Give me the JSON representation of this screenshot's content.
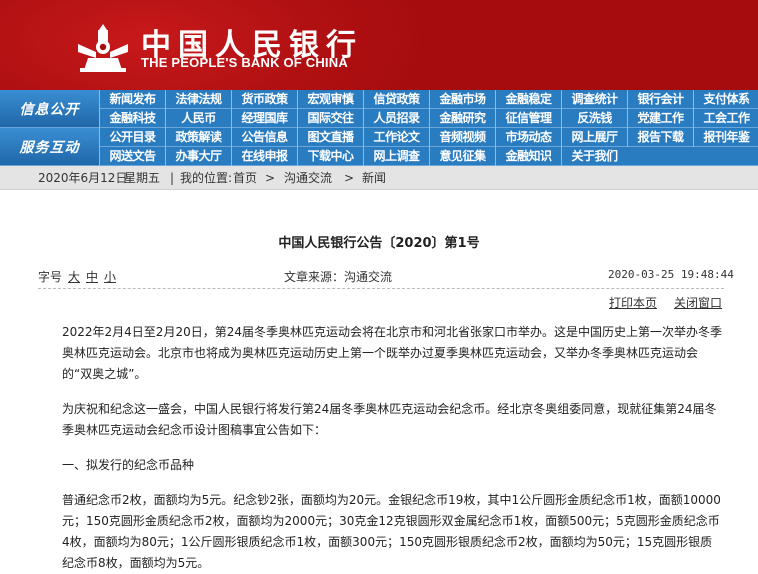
{
  "header": {
    "bank_name_cn": "中国人民银行",
    "bank_name_en": "THE PEOPLE'S BANK OF CHINA",
    "colors": {
      "brand_red": "#a50c0e",
      "nav_blue": "#2778bd"
    }
  },
  "nav": {
    "info_label": "信息公开",
    "service_label": "服务互动",
    "row1": [
      "新闻发布",
      "法律法规",
      "货币政策",
      "宏观审慎",
      "信贷政策",
      "金融市场",
      "金融稳定",
      "调查统计",
      "银行会计",
      "支付体系"
    ],
    "row2": [
      "金融科技",
      "人民币",
      "经理国库",
      "国际交往",
      "人员招录",
      "金融研究",
      "征信管理",
      "反洗钱",
      "党建工作",
      "工会工作"
    ],
    "row3": [
      "公开目录",
      "政策解读",
      "公告信息",
      "图文直播",
      "工作论文",
      "音频视频",
      "市场动态",
      "网上展厅",
      "报告下载",
      "报刊年鉴"
    ],
    "row4": [
      "网送文告",
      "办事大厅",
      "在线申报",
      "下载中心",
      "网上调查",
      "意见征集",
      "金融知识",
      "关于我们"
    ]
  },
  "breadcrumb": {
    "date": "2020年6月12日",
    "weekday": "星期五",
    "sep": "|",
    "location_label": "我的位置:",
    "home": "首页",
    "arrow1": ">",
    "section": "沟通交流",
    "arrow2": ">",
    "page": "新闻"
  },
  "article": {
    "title": "中国人民银行公告〔2020〕第1号",
    "font_size_label": "字号",
    "size_large": "大",
    "size_medium": "中",
    "size_small": "小",
    "source_label": "文章来源：沟通交流",
    "datetime": "2020-03-25 19:48:44",
    "print_label": "打印本页",
    "close_label": "关闭窗口",
    "paragraphs": [
      "2022年2月4日至2月20日，第24届冬季奥林匹克运动会将在北京市和河北省张家口市举办。这是中国历史上第一次举办冬季奥林匹克运动会。北京市也将成为奥林匹克运动历史上第一个既举办过夏季奥林匹克运动会，又举办冬季奥林匹克运动会的“双奥之城”。",
      "为庆祝和纪念这一盛会，中国人民银行将发行第24届冬季奥林匹克运动会纪念币。经北京冬奥组委同意，现就征集第24届冬季奥林匹克运动会纪念币设计图稿事宜公告如下：",
      "一、拟发行的纪念币品种",
      "普通纪念币2枚，面额均为5元。纪念钞2张，面额均为20元。金银纪念币19枚，其中1公斤圆形金质纪念币1枚，面额10000元；150克圆形金质纪念币2枚，面额均为2000元；30克金12克银圆形双金属纪念币1枚，面额500元；5克圆形金质纪念币4枚，面额均为80元；1公斤圆形银质纪念币1枚，面额300元；150克圆形银质纪念币2枚，面额均为50元；15克圆形银质纪念币8枚，面额均为5元。"
    ]
  }
}
